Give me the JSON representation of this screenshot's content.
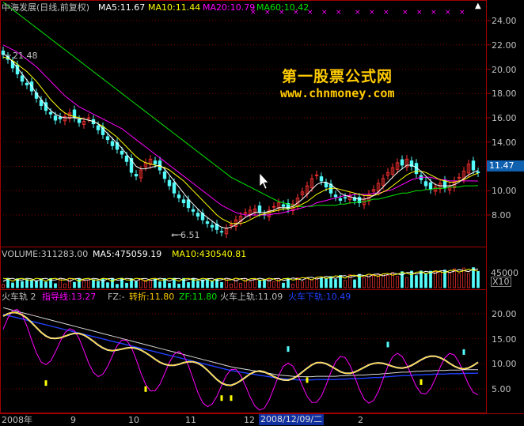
{
  "header": {
    "title": "中海发展(日线,前复权)",
    "ma5": "MA5:11.67",
    "ma10": "MA10:11.44",
    "ma20": "MA20:10.79",
    "ma60": "MA60:10.42"
  },
  "price_axis": [
    "24.00",
    "22.00",
    "20.00",
    "18.00",
    "16.00",
    "14.00",
    "12.00",
    "10.00",
    "8.00"
  ],
  "last_price": "11.47",
  "annotations": {
    "high": "21.48",
    "low": "6.51"
  },
  "watermark": {
    "line1": "第一股票公式网",
    "line2": "www.chnmoney.com"
  },
  "volume_header": {
    "volume": "VOLUME:311283.00",
    "ma5": "MA5:475059.19",
    "ma10": "MA10:430540.81"
  },
  "volume_axis": {
    "value": "45000",
    "unit": "X10"
  },
  "indicator_header": {
    "name": "火车轨 2",
    "guide": "指导线:13.27",
    "fz": "FZ:-",
    "turn": "转折:11.80",
    "zf": "ZF:11.80",
    "upper": "火车上轨:11.09",
    "lower": "火车下轨:10.49"
  },
  "indicator_axis": [
    "20.00",
    "15.00",
    "10.00",
    "5.00"
  ],
  "date_axis": {
    "labels": [
      "2008年",
      "9",
      "10",
      "11",
      "12",
      "2"
    ],
    "cursor_date": "2008/12/09/二"
  },
  "colors": {
    "up": "#ff3232",
    "down": "#54fcfc",
    "ma5": "#ffffff",
    "ma10": "#ffff00",
    "ma20": "#ff00ff",
    "ma60": "#00e600",
    "grid": "#800000",
    "panel_border": "#a00000"
  },
  "chart_data": {
    "type": "line",
    "x_months": [
      "2008-08",
      "2008-09",
      "2008-10",
      "2008-11",
      "2008-12",
      "2009-01",
      "2009-02"
    ],
    "price_ylim": [
      7,
      25
    ],
    "close": [
      21.2,
      20.8,
      20.1,
      19.6,
      19.0,
      18.7,
      18.2,
      17.6,
      17.0,
      16.6,
      16.3,
      15.8,
      15.9,
      16.1,
      16.4,
      16.0,
      15.6,
      15.7,
      16.0,
      15.5,
      15.0,
      14.6,
      14.2,
      13.7,
      13.4,
      13.0,
      12.4,
      11.5,
      11.2,
      11.7,
      12.3,
      12.6,
      12.2,
      11.7,
      11.0,
      10.4,
      9.8,
      9.4,
      9.0,
      8.6,
      8.3,
      7.9,
      7.6,
      7.3,
      7.0,
      6.8,
      6.6,
      6.9,
      7.2,
      7.6,
      7.9,
      8.2,
      8.4,
      8.5,
      8.2,
      8.0,
      8.4,
      8.7,
      9.0,
      8.7,
      8.5,
      8.9,
      9.4,
      9.9,
      10.4,
      11.0,
      11.3,
      10.8,
      10.3,
      9.8,
      9.5,
      9.2,
      9.4,
      9.6,
      9.2,
      9.0,
      9.3,
      9.7,
      10.1,
      10.6,
      11.0,
      11.5,
      11.9,
      12.3,
      12.1,
      12.6,
      12.0,
      11.4,
      10.9,
      10.4,
      10.1,
      10.3,
      10.6,
      10.2,
      10.4,
      10.8,
      11.1,
      11.6,
      12.2,
      11.7,
      11.47
    ],
    "ma5": [
      21.3,
      21.0,
      20.6,
      20.1,
      19.6,
      19.1,
      18.6,
      18.0,
      17.5,
      17.0,
      16.6,
      16.3,
      16.1,
      16.0,
      16.0,
      16.0,
      15.9,
      15.9,
      15.8,
      15.7,
      15.5,
      15.1,
      14.7,
      14.3,
      13.9,
      13.5,
      13.0,
      12.5,
      12.0,
      11.8,
      11.8,
      11.9,
      12.0,
      12.1,
      11.8,
      11.3,
      10.8,
      10.3,
      9.8,
      9.3,
      8.9,
      8.5,
      8.1,
      7.8,
      7.5,
      7.2,
      7.0,
      6.9,
      7.0,
      7.2,
      7.5,
      7.8,
      8.0,
      8.2,
      8.2,
      8.2,
      8.3,
      8.4,
      8.6,
      8.6,
      8.6,
      8.7,
      9.0,
      9.3,
      9.7,
      10.1,
      10.5,
      10.7,
      10.7,
      10.5,
      10.2,
      9.8,
      9.6,
      9.5,
      9.4,
      9.3,
      9.3,
      9.4,
      9.6,
      9.9,
      10.3,
      10.7,
      11.1,
      11.5,
      11.8,
      12.1,
      12.1,
      11.9,
      11.6,
      11.2,
      10.8,
      10.5,
      10.4,
      10.4,
      10.4,
      10.5,
      10.7,
      11.0,
      11.3,
      11.5,
      11.67
    ],
    "ma10": [
      21.0,
      20.9,
      20.7,
      20.4,
      20.1,
      19.8,
      19.4,
      19.0,
      18.5,
      18.0,
      17.5,
      17.1,
      16.7,
      16.4,
      16.2,
      16.1,
      16.0,
      15.9,
      15.8,
      15.7,
      15.5,
      15.3,
      15.0,
      14.7,
      14.4,
      14.0,
      13.6,
      13.2,
      12.8,
      12.5,
      12.3,
      12.2,
      12.1,
      12.0,
      11.9,
      11.7,
      11.4,
      11.1,
      10.8,
      10.4,
      10.0,
      9.6,
      9.2,
      8.8,
      8.4,
      8.0,
      7.7,
      7.5,
      7.3,
      7.3,
      7.3,
      7.4,
      7.6,
      7.8,
      8.0,
      8.1,
      8.2,
      8.3,
      8.4,
      8.5,
      8.5,
      8.6,
      8.7,
      8.9,
      9.1,
      9.4,
      9.7,
      9.9,
      10.1,
      10.2,
      10.2,
      10.1,
      10.0,
      9.9,
      9.8,
      9.7,
      9.6,
      9.6,
      9.6,
      9.7,
      9.9,
      10.1,
      10.4,
      10.7,
      11.0,
      11.3,
      11.5,
      11.6,
      11.6,
      11.5,
      11.3,
      11.1,
      10.9,
      10.8,
      10.7,
      10.7,
      10.8,
      10.9,
      11.1,
      11.3,
      11.44
    ],
    "ma20": [
      22.0,
      21.8,
      21.6,
      21.4,
      21.1,
      20.8,
      20.5,
      20.2,
      19.8,
      19.4,
      19.0,
      18.6,
      18.2,
      17.8,
      17.5,
      17.2,
      16.9,
      16.7,
      16.5,
      16.3,
      16.1,
      15.9,
      15.7,
      15.5,
      15.3,
      15.1,
      14.8,
      14.5,
      14.2,
      13.9,
      13.6,
      13.3,
      13.0,
      12.7,
      12.4,
      12.1,
      11.8,
      11.5,
      11.2,
      10.9,
      10.6,
      10.3,
      10.0,
      9.7,
      9.4,
      9.1,
      8.8,
      8.6,
      8.4,
      8.2,
      8.1,
      8.0,
      8.0,
      8.0,
      8.0,
      8.0,
      8.0,
      8.1,
      8.1,
      8.2,
      8.3,
      8.4,
      8.5,
      8.6,
      8.7,
      8.8,
      9.0,
      9.1,
      9.2,
      9.3,
      9.4,
      9.5,
      9.6,
      9.6,
      9.7,
      9.7,
      9.7,
      9.7,
      9.8,
      9.8,
      9.9,
      10.0,
      10.1,
      10.3,
      10.5,
      10.7,
      10.9,
      11.0,
      11.1,
      11.1,
      11.1,
      11.0,
      10.9,
      10.9,
      10.8,
      10.8,
      10.8,
      10.8,
      10.8,
      10.8,
      10.79
    ],
    "ma60": [
      25.5,
      25.2,
      24.9,
      24.6,
      24.3,
      24.0,
      23.7,
      23.4,
      23.1,
      22.8,
      22.5,
      22.2,
      21.9,
      21.6,
      21.3,
      21.0,
      20.7,
      20.4,
      20.1,
      19.8,
      19.5,
      19.2,
      18.9,
      18.6,
      18.3,
      18.0,
      17.7,
      17.4,
      17.1,
      16.8,
      16.5,
      16.2,
      15.9,
      15.6,
      15.3,
      15.0,
      14.7,
      14.4,
      14.1,
      13.8,
      13.5,
      13.2,
      12.9,
      12.6,
      12.3,
      12.0,
      11.7,
      11.4,
      11.1,
      10.9,
      10.7,
      10.5,
      10.3,
      10.1,
      9.9,
      9.7,
      9.5,
      9.3,
      9.1,
      9.0,
      8.9,
      8.8,
      8.7,
      8.7,
      8.7,
      8.7,
      8.8,
      8.8,
      8.8,
      8.8,
      8.8,
      8.9,
      8.9,
      9.0,
      9.0,
      9.1,
      9.1,
      9.2,
      9.3,
      9.3,
      9.4,
      9.5,
      9.6,
      9.7,
      9.8,
      9.8,
      9.9,
      10.0,
      10.0,
      10.1,
      10.1,
      10.2,
      10.2,
      10.2,
      10.3,
      10.3,
      10.3,
      10.4,
      10.4,
      10.4,
      10.42
    ]
  }
}
